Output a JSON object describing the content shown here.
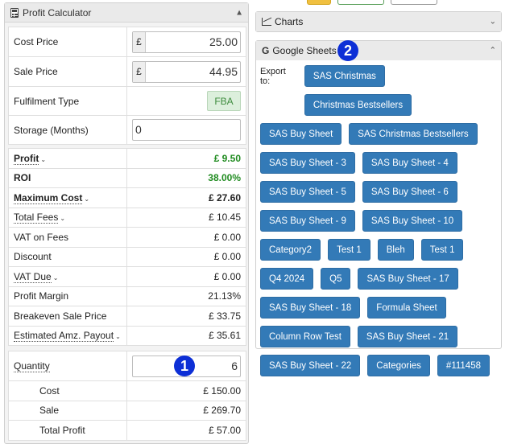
{
  "calculator": {
    "title": "Profit Calculator",
    "currency_symbol": "£",
    "cost_price": {
      "label": "Cost Price",
      "value": "25.00"
    },
    "sale_price": {
      "label": "Sale Price",
      "value": "44.95"
    },
    "fulfilment": {
      "label": "Fulfilment Type",
      "value": "FBA"
    },
    "storage": {
      "label": "Storage (Months)",
      "value": "0"
    },
    "rows": {
      "profit": {
        "label": "Profit",
        "value": "£ 9.50"
      },
      "roi": {
        "label": "ROI",
        "value": "38.00%"
      },
      "max_cost": {
        "label": "Maximum Cost",
        "value": "£ 27.60"
      },
      "total_fees": {
        "label": "Total Fees",
        "value": "£ 10.45"
      },
      "vat_fees": {
        "label": "VAT on Fees",
        "value": "£ 0.00"
      },
      "discount": {
        "label": "Discount",
        "value": "£ 0.00"
      },
      "vat_due": {
        "label": "VAT Due",
        "value": "£ 0.00"
      },
      "profit_margin": {
        "label": "Profit Margin",
        "value": "21.13%"
      },
      "breakeven": {
        "label": "Breakeven Sale Price",
        "value": "£ 33.75"
      },
      "payout": {
        "label": "Estimated Amz. Payout",
        "value": "£ 35.61"
      }
    },
    "quantity": {
      "label": "Quantity",
      "value": "6"
    },
    "qty_rows": {
      "cost": {
        "label": "Cost",
        "value": "£ 150.00"
      },
      "sale": {
        "label": "Sale",
        "value": "£ 269.70"
      },
      "total_profit": {
        "label": "Total Profit",
        "value": "£ 57.00"
      }
    }
  },
  "charts": {
    "title": "Charts"
  },
  "google_sheets": {
    "title": "Google Sheets",
    "export_label": "Export to:",
    "buttons": [
      "SAS Christmas",
      "Christmas Bestsellers",
      "SAS Buy Sheet",
      "SAS Christmas Bestsellers",
      "SAS Buy Sheet - 3",
      "SAS Buy Sheet - 4",
      "SAS Buy Sheet - 5",
      "SAS Buy Sheet - 6",
      "SAS Buy Sheet - 9",
      "SAS Buy Sheet - 10",
      "Category2",
      "Test 1",
      "Bleh",
      "Test 1",
      "Q4 2024",
      "Q5",
      "SAS Buy Sheet - 17",
      "SAS Buy Sheet - 18",
      "Formula Sheet",
      "Column Row Test",
      "SAS Buy Sheet - 21",
      "SAS Buy Sheet - 22",
      "Categories",
      "#111458"
    ]
  },
  "markers": {
    "one": "1",
    "two": "2"
  },
  "colors": {
    "primary_button": "#337ab7",
    "profit_green": "#218c21",
    "marker_blue": "#0d2fd6"
  },
  "icons": {
    "calculator": "calculator-icon",
    "charts": "bar-chart-icon",
    "sheets": "google-g-icon"
  }
}
